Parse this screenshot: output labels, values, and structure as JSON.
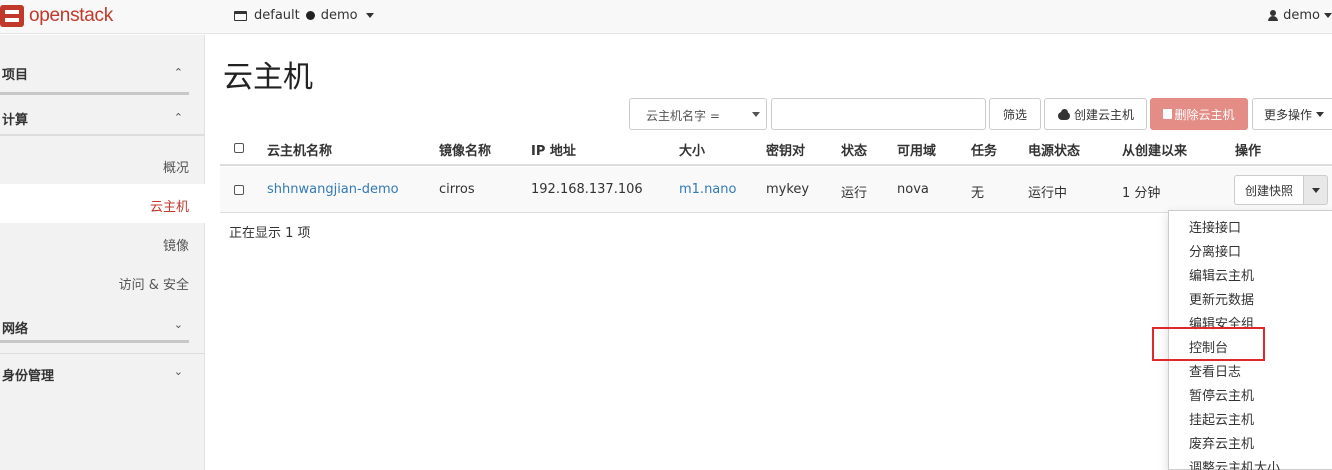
{
  "navbar": {
    "brand": "openstack",
    "domain": "default",
    "project": "demo",
    "user": "demo"
  },
  "sidebar": {
    "sections": [
      {
        "label": "项目"
      },
      {
        "label": "计算"
      },
      {
        "label": "网络"
      },
      {
        "label": "身份管理"
      }
    ],
    "compute_items": [
      {
        "label": "概况"
      },
      {
        "label": "云主机"
      },
      {
        "label": "镜像"
      },
      {
        "label": "访问 & 安全"
      }
    ]
  },
  "main": {
    "title": "云主机",
    "filter_select": "云主机名字 =",
    "filter_input_value": "",
    "buttons": {
      "filter": "筛选",
      "create": "创建云主机",
      "delete": "删除云主机",
      "more": "更多操作"
    },
    "table": {
      "headers": [
        "云主机名称",
        "镜像名称",
        "IP 地址",
        "大小",
        "密钥对",
        "状态",
        "可用域",
        "任务",
        "电源状态",
        "从创建以来",
        "操作"
      ],
      "rows": [
        {
          "name": "shhnwangjian-demo",
          "image": "cirros",
          "ip": "192.168.137.106",
          "size": "m1.nano",
          "keypair": "mykey",
          "status": "运行",
          "zone": "nova",
          "task": "无",
          "power": "运行中",
          "age": "1 分钟",
          "action": "创建快照"
        }
      ]
    },
    "count_text": "正在显示 1 项",
    "dropdown": [
      "连接接口",
      "分离接口",
      "编辑云主机",
      "更新元数据",
      "编辑安全组",
      "控制台",
      "查看日志",
      "暂停云主机",
      "挂起云主机",
      "废弃云主机",
      "调整云主机大小"
    ]
  },
  "colors": {
    "brand_red": "#c0392b",
    "link_blue": "#337ab7",
    "danger_button": "#e48c86",
    "highlight_box": "#e0282a"
  }
}
